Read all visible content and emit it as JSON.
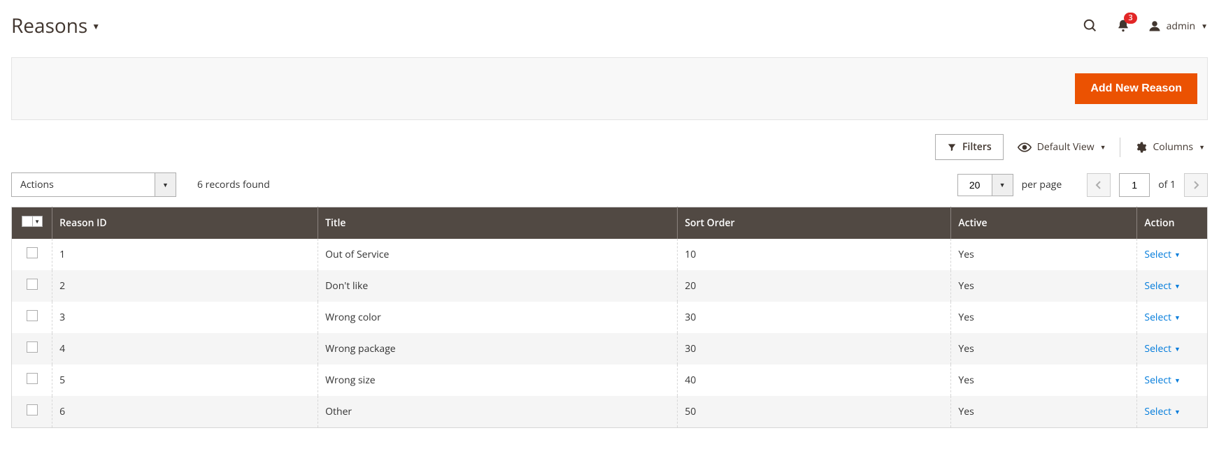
{
  "header": {
    "title": "Reasons",
    "notifications_count": "3",
    "admin_user": "admin"
  },
  "actions_bar": {
    "add_button": "Add New Reason"
  },
  "toolbar": {
    "filters_label": "Filters",
    "view_label": "Default View",
    "columns_label": "Columns"
  },
  "grid_controls": {
    "actions_placeholder": "Actions",
    "records_found": "6 records found",
    "page_size": "20",
    "per_page_label": "per page",
    "current_page": "1",
    "of_label": "of",
    "total_pages": "1"
  },
  "table": {
    "columns": {
      "reason_id": "Reason ID",
      "title": "Title",
      "sort_order": "Sort Order",
      "active": "Active",
      "action": "Action"
    },
    "action_label": "Select",
    "rows": [
      {
        "id": "1",
        "title": "Out of Service",
        "sort": "10",
        "active": "Yes"
      },
      {
        "id": "2",
        "title": "Don't like",
        "sort": "20",
        "active": "Yes"
      },
      {
        "id": "3",
        "title": "Wrong color",
        "sort": "30",
        "active": "Yes"
      },
      {
        "id": "4",
        "title": "Wrong package",
        "sort": "30",
        "active": "Yes"
      },
      {
        "id": "5",
        "title": "Wrong size",
        "sort": "40",
        "active": "Yes"
      },
      {
        "id": "6",
        "title": "Other",
        "sort": "50",
        "active": "Yes"
      }
    ]
  }
}
